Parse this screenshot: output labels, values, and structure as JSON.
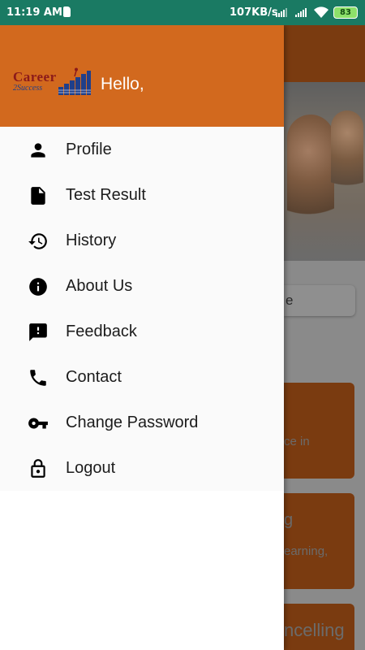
{
  "status_bar": {
    "time": "11:19 AM",
    "network_speed": "107KB/s",
    "battery_level": "83"
  },
  "drawer": {
    "greeting": "Hello,",
    "logo": {
      "career": "Career",
      "tagline": "2Success"
    },
    "items": [
      {
        "label": "Profile",
        "icon": "person-icon"
      },
      {
        "label": "Test Result",
        "icon": "file-icon"
      },
      {
        "label": "History",
        "icon": "history-icon"
      },
      {
        "label": "About Us",
        "icon": "info-icon"
      },
      {
        "label": "Feedback",
        "icon": "feedback-icon"
      },
      {
        "label": "Contact",
        "icon": "phone-icon"
      },
      {
        "label": "Change Password",
        "icon": "key-icon"
      },
      {
        "label": "Logout",
        "icon": "lock-icon"
      }
    ]
  },
  "background": {
    "search_text_fragment": "e",
    "cards": [
      {
        "text": "ce in"
      },
      {
        "title": "g",
        "text": "earning,"
      },
      {
        "title": "ncelling"
      }
    ]
  },
  "colors": {
    "status_bar": "#1a7a63",
    "drawer_header": "#d2691e",
    "accent_dark": "#7a3b10",
    "battery": "#8de06a"
  }
}
